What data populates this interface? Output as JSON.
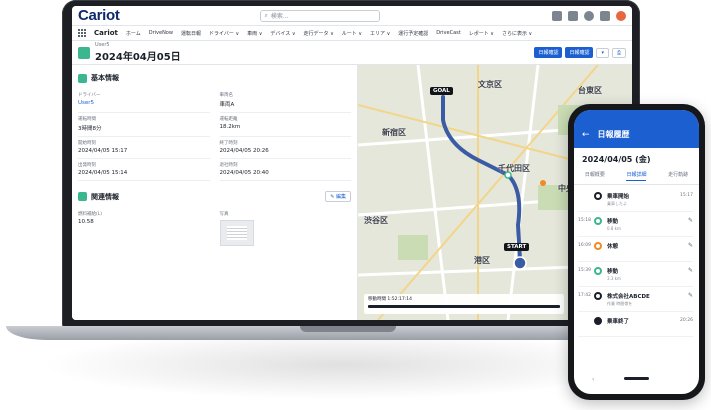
{
  "app": {
    "brand": "Cariot",
    "app_name": "Cariot",
    "search_placeholder": "検索..."
  },
  "nav": [
    "ホーム",
    "DriveNow",
    "運転日報",
    "ドライバー ∨",
    "車両 ∨",
    "デバイス ∨",
    "走行データ ∨",
    "ルート ∨",
    "エリア ∨",
    "運行予定確認",
    "DriveCast",
    "レポート ∨",
    "さらに表示 ∨"
  ],
  "record": {
    "object": "User5",
    "title": "2024年04月05日",
    "actions": [
      "日報確認",
      "日報確認"
    ]
  },
  "basic": {
    "title": "基本情報",
    "fields": [
      {
        "label": "ドライバー",
        "value": "User5",
        "link": true
      },
      {
        "label": "車両名",
        "value": "車両A",
        "link": false
      },
      {
        "label": "運転時間",
        "value": "3時間8分",
        "link": false
      },
      {
        "label": "運転距離",
        "value": "18.2km",
        "link": false
      },
      {
        "label": "開始時刻",
        "value": "2024/04/05 15:17",
        "link": false
      },
      {
        "label": "終了時刻",
        "value": "2024/04/05 20:26",
        "link": false
      },
      {
        "label": "出発時刻",
        "value": "2024/04/05 15:14",
        "link": false
      },
      {
        "label": "退社時刻",
        "value": "2024/04/05 20:40",
        "link": false
      }
    ]
  },
  "related": {
    "title": "関連情報",
    "edit_label": "編集",
    "fields": [
      {
        "label": "燃料補給(L)",
        "value": "10.58"
      },
      {
        "label": "写真",
        "value": ""
      }
    ]
  },
  "map": {
    "labels": [
      "文京区",
      "台東区",
      "新宿区",
      "千代田区",
      "中央区",
      "渋谷区",
      "港区"
    ],
    "goal": "GOAL",
    "start": "START",
    "timeline_label": "移動時間 1:52:17:14"
  },
  "phone": {
    "title": "日報履歴",
    "date": "2024/04/05 (金)",
    "tabs": [
      "日報概要",
      "日報詳細",
      "走行軌跡"
    ],
    "active_tab": 1,
    "items": [
      {
        "time": "",
        "name": "乗車開始",
        "meta": "乗車したよ",
        "right": "15:17",
        "dot": "default"
      },
      {
        "time": "15:18",
        "name": "移動",
        "meta": "0.8 km",
        "right": "✎",
        "dot": "green"
      },
      {
        "time": "16:09",
        "name": "休憩",
        "meta": "",
        "right": "✎",
        "dot": "orange"
      },
      {
        "time": "15:39",
        "name": "移動",
        "meta": "3.3 km",
        "right": "✎",
        "dot": "green"
      },
      {
        "time": "17:42",
        "name": "株式会社ABCDE",
        "meta": "作業   時間帯を",
        "right": "✎",
        "dot": "default"
      },
      {
        "time": "",
        "name": "乗車終了",
        "meta": "",
        "right": "20:26",
        "dot": "fill"
      }
    ],
    "prev": "‹"
  }
}
